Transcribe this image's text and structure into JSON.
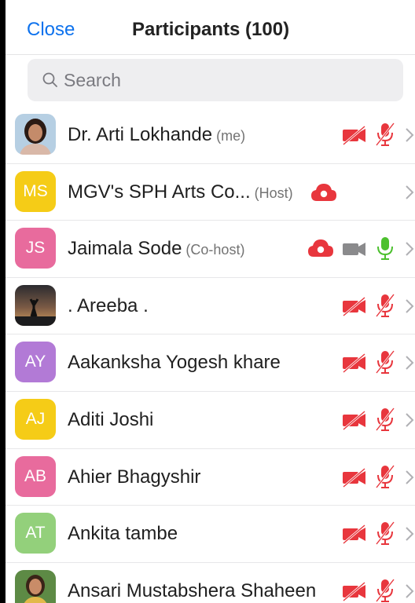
{
  "header": {
    "close_label": "Close",
    "title": "Participants (100)"
  },
  "search": {
    "placeholder": "Search"
  },
  "colors": {
    "accent": "#0e72ed",
    "muted_red": "#e8363d",
    "unmuted_green": "#4cc02e"
  },
  "participants": [
    {
      "name": "Dr. Arti Lokhande",
      "tag": "(me)",
      "avatar_type": "photo-woman",
      "status_icons": [
        "video-off-icon",
        "mic-off-icon"
      ]
    },
    {
      "name": "MGV's SPH Arts Co...",
      "tag": "(Host)",
      "initials": "MS",
      "avatar_color": "#f5cc17",
      "status_icons": [
        "cloud-record-icon"
      ]
    },
    {
      "name": "Jaimala Sode",
      "tag": "(Co-host)",
      "initials": "JS",
      "avatar_color": "#e86b9d",
      "status_icons": [
        "cloud-record-icon",
        "video-on-icon",
        "mic-on-icon"
      ]
    },
    {
      "name": ". Areeba .",
      "tag": "",
      "avatar_type": "photo-sunset",
      "status_icons": [
        "video-off-icon",
        "mic-off-icon"
      ]
    },
    {
      "name": "Aakanksha Yogesh khare",
      "tag": "",
      "initials": "AY",
      "avatar_color": "#b27ad6",
      "status_icons": [
        "video-off-icon",
        "mic-off-icon"
      ]
    },
    {
      "name": "Aditi Joshi",
      "tag": "",
      "initials": "AJ",
      "avatar_color": "#f5cc17",
      "status_icons": [
        "video-off-icon",
        "mic-off-icon"
      ]
    },
    {
      "name": "Ahier Bhagyshir",
      "tag": "",
      "initials": "AB",
      "avatar_color": "#e86b9d",
      "status_icons": [
        "video-off-icon",
        "mic-off-icon"
      ]
    },
    {
      "name": "Ankita tambe",
      "tag": "",
      "initials": "AT",
      "avatar_color": "#93d07b",
      "status_icons": [
        "video-off-icon",
        "mic-off-icon"
      ]
    },
    {
      "name": "Ansari Mustabshera Shaheen",
      "tag": "",
      "avatar_type": "photo-woman-green",
      "status_icons": [
        "video-off-icon",
        "mic-off-icon"
      ]
    }
  ]
}
